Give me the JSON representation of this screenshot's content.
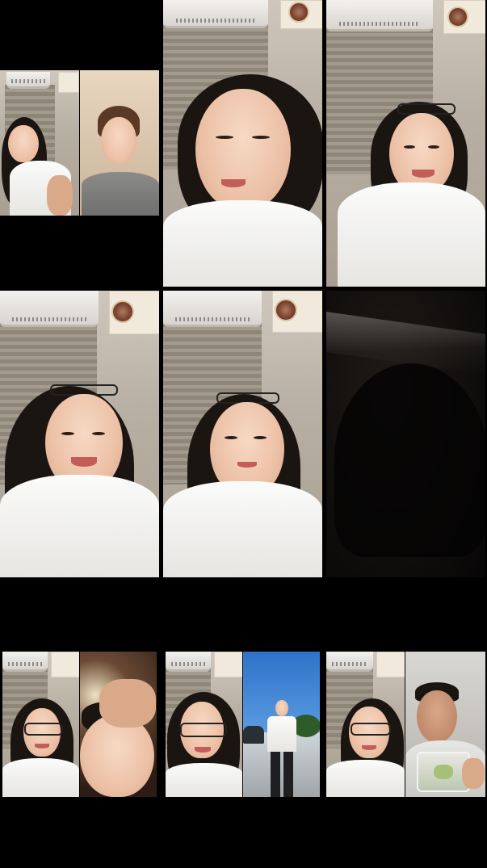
{
  "screen": {
    "background": "#000000"
  },
  "tiles": [
    {
      "id": "split-call-1",
      "left_person": "host-wave",
      "right_person": "guest-grey-shirt"
    },
    {
      "id": "host-eyes-closed"
    },
    {
      "id": "host-smile-1"
    },
    {
      "id": "host-smile-2"
    },
    {
      "id": "host-looking-aside"
    },
    {
      "id": "dark-guest"
    },
    {
      "id": "split-call-2",
      "left_person": "host-glasses",
      "right_person": "guest-closeup"
    },
    {
      "id": "split-call-3",
      "left_person": "host-glasses",
      "right_person": "guest-outdoors"
    },
    {
      "id": "split-call-4",
      "left_person": "host-glasses",
      "right_person": "guest-food"
    }
  ],
  "colors": {
    "shirt": "#fbfbfa",
    "hair": "#1b1512",
    "skin": "#ecc1a6",
    "sky": "#2e73c9"
  }
}
